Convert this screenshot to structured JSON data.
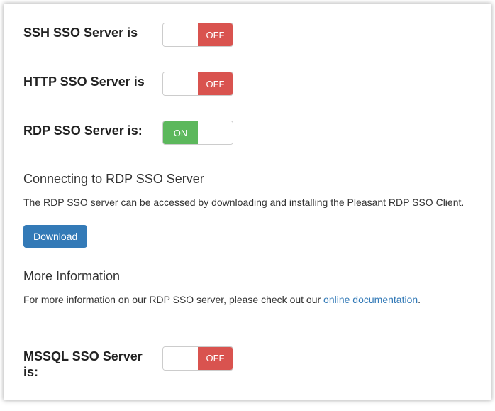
{
  "toggle_labels": {
    "on": "ON",
    "off": "OFF"
  },
  "servers": {
    "ssh": {
      "label": "SSH SSO Server is",
      "state": "off"
    },
    "http": {
      "label": "HTTP SSO Server is",
      "state": "off"
    },
    "rdp": {
      "label": "RDP SSO Server is:",
      "state": "on"
    },
    "mssql": {
      "label": "MSSQL SSO Server is:",
      "state": "off"
    }
  },
  "rdp_section": {
    "connect_title": "Connecting to RDP SSO Server",
    "connect_text": "The RDP SSO server can be accessed by downloading and installing the Pleasant RDP SSO Client.",
    "download_label": "Download",
    "more_title": "More Information",
    "more_text_prefix": "For more information on our RDP SSO server, please check out our ",
    "more_link_text": "online documentation",
    "more_text_suffix": "."
  }
}
